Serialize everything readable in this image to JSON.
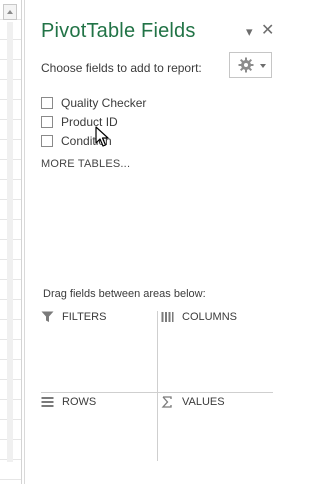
{
  "header": {
    "title": "PivotTable Fields",
    "dropdown_glyph": "▾",
    "close_glyph": "✕"
  },
  "choose_label": "Choose fields to add to report:",
  "fields": [
    {
      "label": "Quality Checker",
      "checked": false
    },
    {
      "label": "Product ID",
      "checked": false
    },
    {
      "label": "Condition",
      "checked": false
    }
  ],
  "more_tables": "MORE TABLES...",
  "drag_label": "Drag fields between areas below:",
  "areas": {
    "filters": "FILTERS",
    "columns": "COLUMNS",
    "rows": "ROWS",
    "values": "VALUES"
  },
  "colors": {
    "title": "#217346",
    "text": "#3b3b3b",
    "divider": "#cfcfcf"
  },
  "icons": {
    "tools": "gear-icon",
    "filters": "filter-icon",
    "columns": "columns-icon",
    "rows": "rows-icon",
    "values": "sigma-icon"
  }
}
